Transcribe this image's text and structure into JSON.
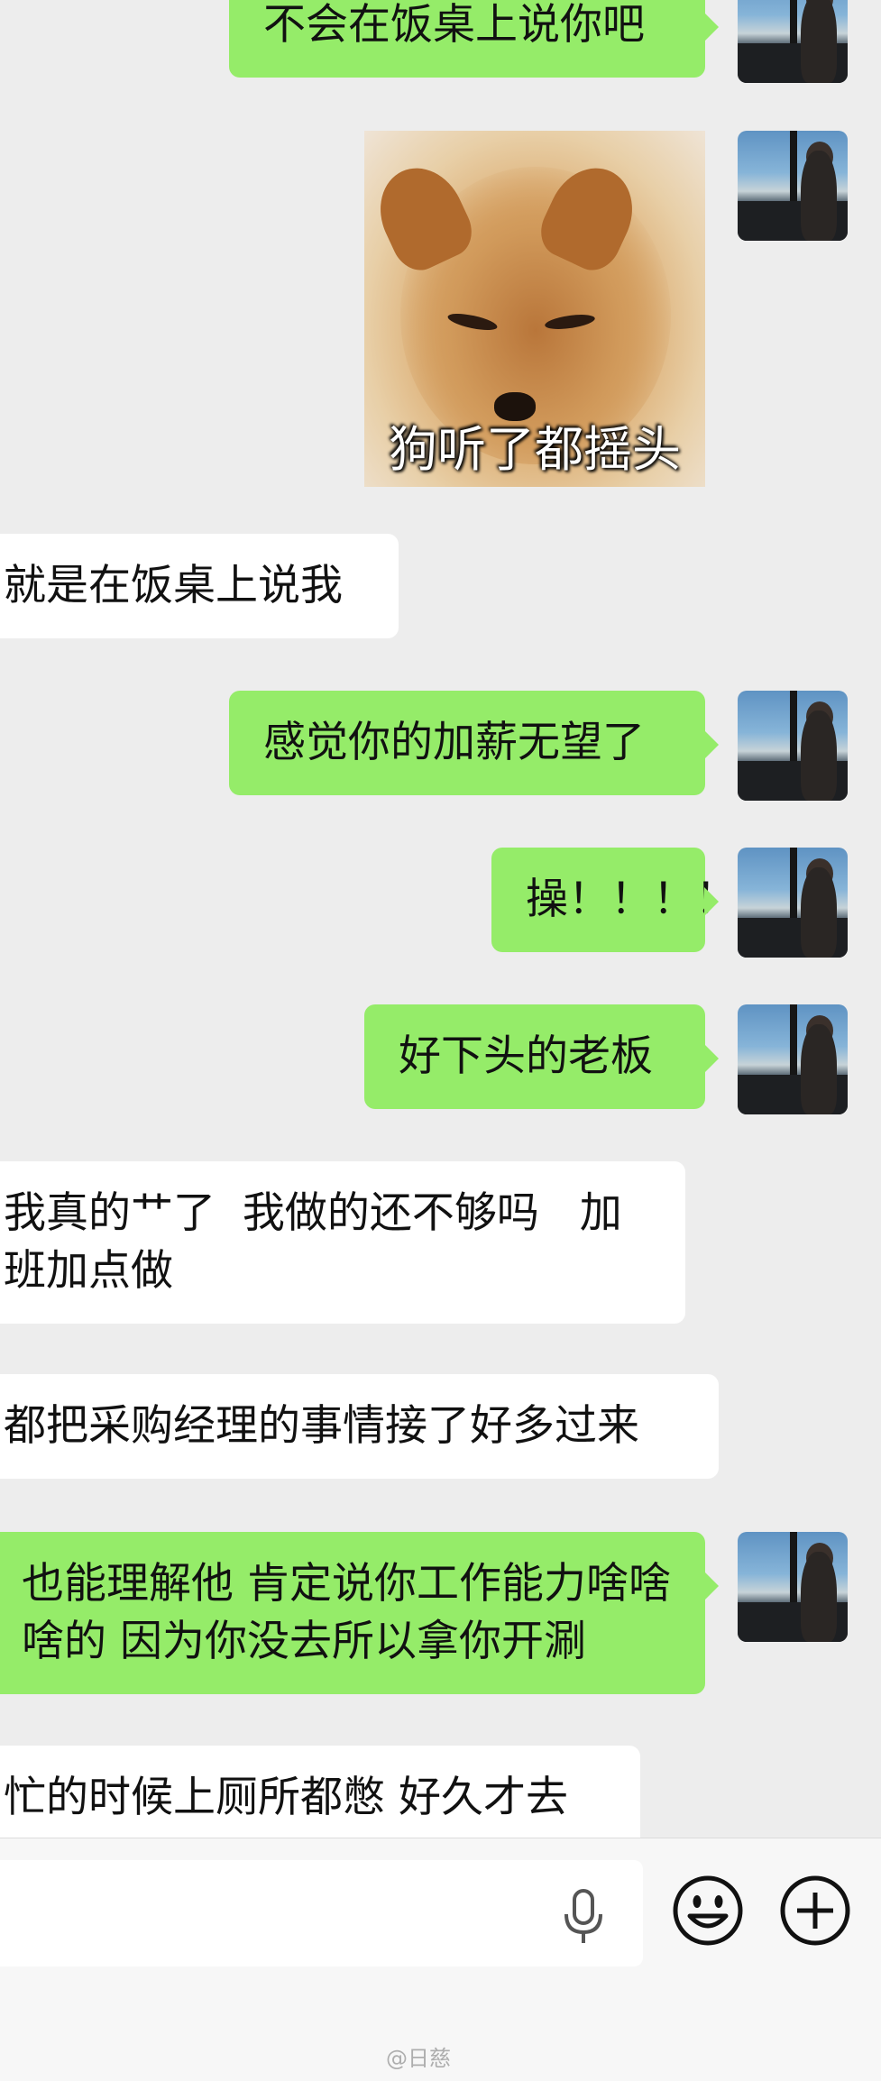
{
  "messages": [
    {
      "sender": "me",
      "type": "text",
      "text": "不会在饭桌上说你吧"
    },
    {
      "sender": "me",
      "type": "sticker",
      "caption": "狗听了都摇头"
    },
    {
      "sender": "other",
      "type": "text",
      "text": "就是在饭桌上说我"
    },
    {
      "sender": "me",
      "type": "text",
      "text": "感觉你的加薪无望了"
    },
    {
      "sender": "me",
      "type": "text",
      "text": "操！！！！"
    },
    {
      "sender": "me",
      "type": "text",
      "text": "好下头的老板"
    },
    {
      "sender": "other",
      "type": "text",
      "text": "我真的艹了  我做的还不够吗   加班加点做"
    },
    {
      "sender": "other",
      "type": "text",
      "text": "都把采购经理的事情接了好多过来"
    },
    {
      "sender": "me",
      "type": "text",
      "text": "也能理解他 肯定说你工作能力啥啥啥的 因为你没去所以拿你开涮"
    },
    {
      "sender": "other",
      "type": "text",
      "text": "忙的时候上厕所都憋 好久才去"
    }
  ],
  "input_bar": {
    "icons": [
      "microphone-icon",
      "emoji-icon",
      "plus-icon"
    ]
  },
  "watermark": "@日慈"
}
